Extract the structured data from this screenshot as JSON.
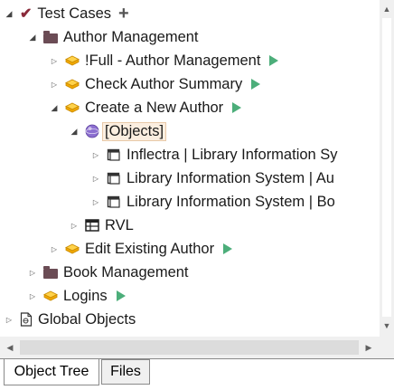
{
  "tree": {
    "root": {
      "label": "Test Cases"
    },
    "author_management": {
      "label": "Author Management"
    },
    "full_author_management": {
      "label": "!Full - Author Management"
    },
    "check_author_summary": {
      "label": "Check Author Summary"
    },
    "create_new_author": {
      "label": "Create a New Author"
    },
    "objects": {
      "label": "[Objects]"
    },
    "objects_items": [
      {
        "label": "Inflectra | Library Information Sy"
      },
      {
        "label": "Library Information System | Au"
      },
      {
        "label": "Library Information System | Bo"
      }
    ],
    "rvl": {
      "label": "RVL"
    },
    "edit_existing_author": {
      "label": "Edit Existing Author"
    },
    "book_management": {
      "label": "Book Management"
    },
    "logins": {
      "label": "Logins"
    },
    "global_objects": {
      "label": "Global Objects"
    }
  },
  "tabs": [
    {
      "label": "Object Tree"
    },
    {
      "label": "Files"
    }
  ],
  "colors": {
    "play": "#4cae7a",
    "folder": "#6b4c55",
    "testcase": "#f2a900",
    "check": "#8a2a3a"
  }
}
